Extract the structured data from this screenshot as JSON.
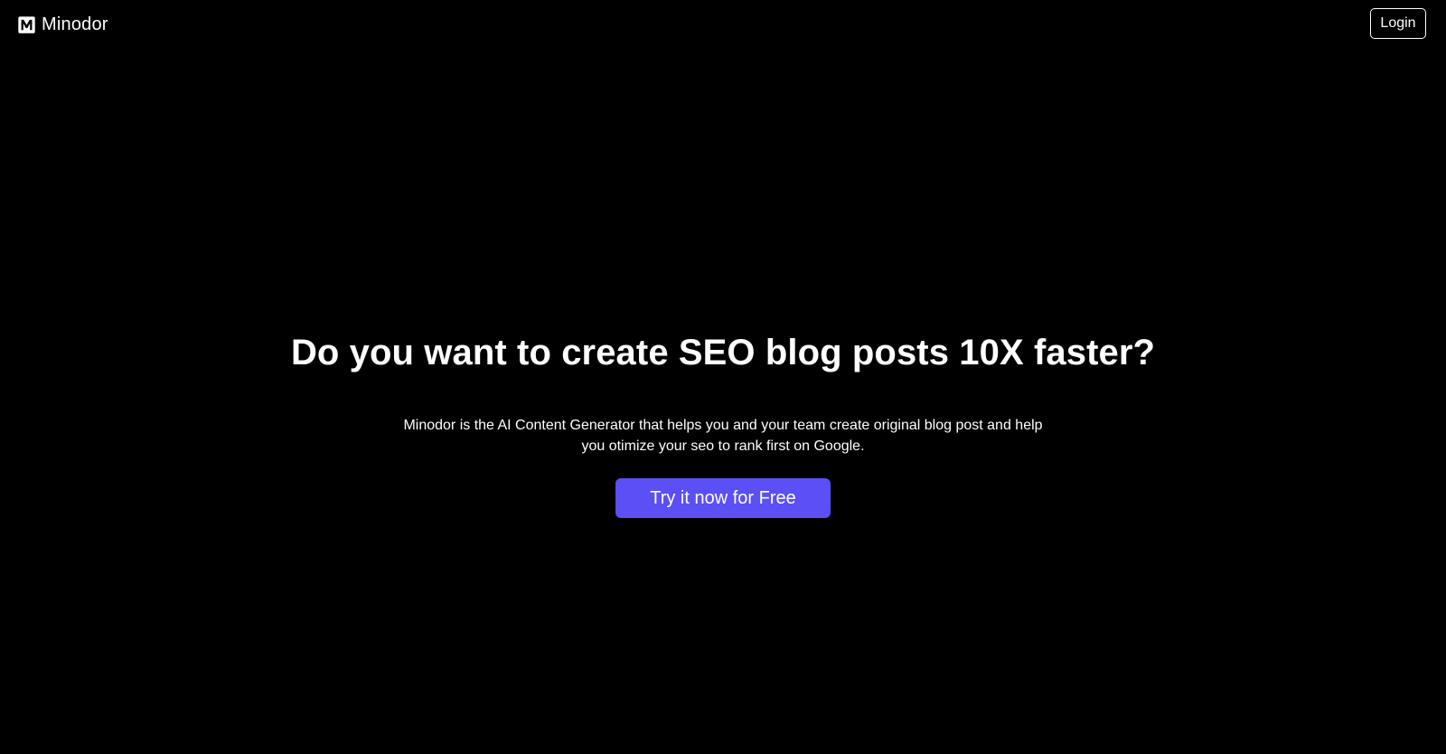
{
  "header": {
    "brand": {
      "name": "Minodor",
      "logo_icon": "minodor-m-logo-icon"
    },
    "login_label": "Login"
  },
  "hero": {
    "title": "Do you want to create SEO blog posts 10X faster?",
    "description_line1": "Minodor is the AI Content Generator that helps you and your team create original blog post and help",
    "description_line2": "you otimize your seo to rank first on Google.",
    "cta_label": "Try it now for Free"
  },
  "colors": {
    "background": "#000000",
    "text": "#ffffff",
    "accent": "#5b4ff5"
  }
}
